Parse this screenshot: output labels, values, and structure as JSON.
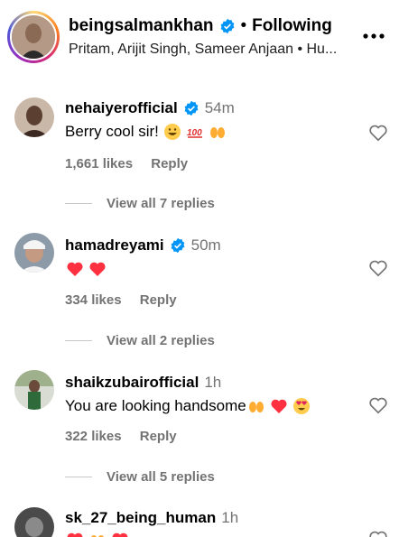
{
  "header": {
    "username": "beingsalmankhan",
    "separator": "•",
    "following_label": "Following",
    "audio": "Pritam, Arijit Singh, Sameer Anjaan • Hu..."
  },
  "comments": [
    {
      "username": "nehaiyerofficial",
      "verified": true,
      "time": "54m",
      "text": "Berry cool sir!",
      "emojis": [
        "grinning-face",
        "hundred-points",
        "raising-hands"
      ],
      "likes": "1,661 likes",
      "reply_label": "Reply",
      "view_replies": "View all 7 replies"
    },
    {
      "username": "hamadreyami",
      "verified": true,
      "time": "50m",
      "text": "",
      "emojis": [
        "red-heart",
        "red-heart"
      ],
      "likes": "334 likes",
      "reply_label": "Reply",
      "view_replies": "View all 2 replies"
    },
    {
      "username": "shaikzubairofficial",
      "verified": false,
      "time": "1h",
      "text": "You are looking handsome",
      "emojis": [
        "raising-hands",
        "red-heart",
        "heart-eyes"
      ],
      "likes": "322 likes",
      "reply_label": "Reply",
      "view_replies": "View all 5 replies"
    },
    {
      "username": "sk_27_being_human",
      "verified": false,
      "time": "1h",
      "text": "",
      "emojis": [
        "red-heart",
        "raising-hands",
        "red-heart"
      ]
    }
  ],
  "colors": {
    "verified": "#0095f6",
    "muted": "#737373",
    "heart": "#ff3040"
  }
}
